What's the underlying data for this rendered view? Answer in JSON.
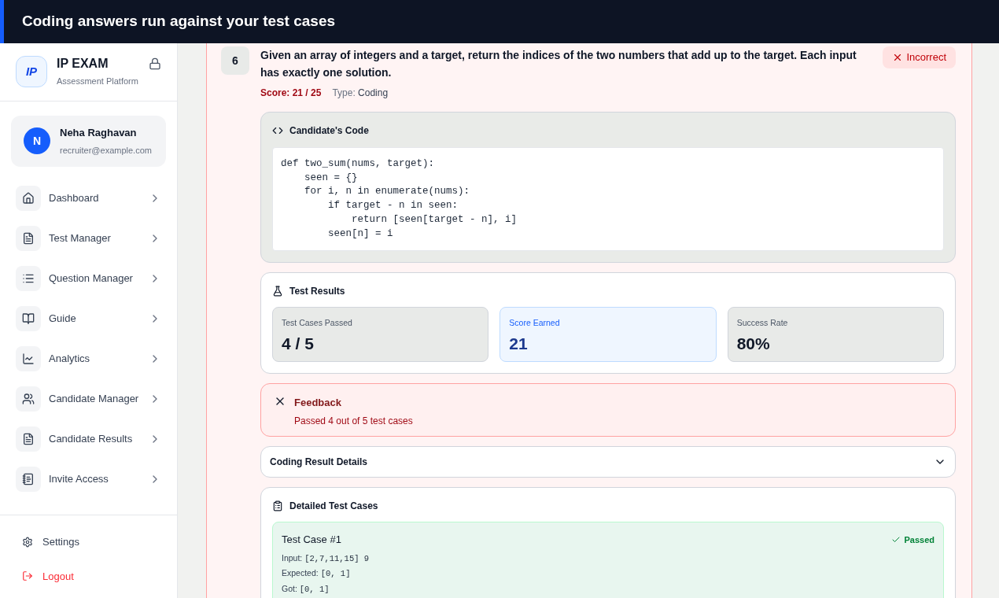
{
  "header": {
    "title": "Coding answers run against your test cases"
  },
  "sidebar": {
    "brand": {
      "logo": "IP",
      "name": "IP EXAM",
      "subtitle": "Assessment Platform"
    },
    "user": {
      "initial": "N",
      "name": "Neha Raghavan",
      "email": "recruiter@example.com"
    },
    "items": [
      {
        "label": "Dashboard",
        "kind": "home"
      },
      {
        "label": "Test Manager",
        "kind": "file"
      },
      {
        "label": "Question Manager",
        "kind": "list"
      },
      {
        "label": "Guide",
        "kind": "book"
      },
      {
        "label": "Analytics",
        "kind": "chart"
      },
      {
        "label": "Candidate Manager",
        "kind": "users"
      },
      {
        "label": "Candidate Results",
        "kind": "file"
      },
      {
        "label": "Invite Access",
        "kind": "doc"
      }
    ],
    "footer": [
      {
        "label": "Settings",
        "kind": "settings"
      },
      {
        "label": "Logout",
        "kind": "logout"
      }
    ]
  },
  "question": {
    "number": "6",
    "text": "Given an array of integers and a target, return the indices of the two numbers that add up to the target. Each input has exactly one solution.",
    "status": "Incorrect",
    "score_label": "Score: 21 / 25",
    "type_label": "Type:",
    "type_value": "Coding",
    "code": {
      "title": "Candidate's Code",
      "lines": [
        "def two_sum(nums, target):",
        "    seen = {}",
        "    for i, n in enumerate(nums):",
        "        if target - n in seen:",
        "            return [seen[target - n], i]",
        "        seen[n] = i"
      ]
    },
    "results": {
      "title": "Test Results",
      "stats": [
        {
          "label": "Test Cases Passed",
          "value": "4 / 5",
          "kind": "neutral"
        },
        {
          "label": "Score Earned",
          "value": "21",
          "kind": "accent"
        },
        {
          "label": "Success Rate",
          "value": "80%",
          "kind": "neutral"
        }
      ]
    },
    "feedback": {
      "title": "Feedback",
      "text": "Passed 4 out of 5 test cases"
    },
    "details": {
      "title": "Coding Result Details",
      "expanded": false
    },
    "test_cases": {
      "title": "Detailed Test Cases",
      "items": [
        {
          "title": "Test Case #1",
          "status": "Passed",
          "passed": true,
          "rows": [
            {
              "label": "Input:",
              "value": "[2,7,11,15] 9"
            },
            {
              "label": "Expected:",
              "value": "[0, 1]"
            },
            {
              "label": "Got:",
              "value": "[0, 1]"
            }
          ]
        }
      ]
    }
  }
}
